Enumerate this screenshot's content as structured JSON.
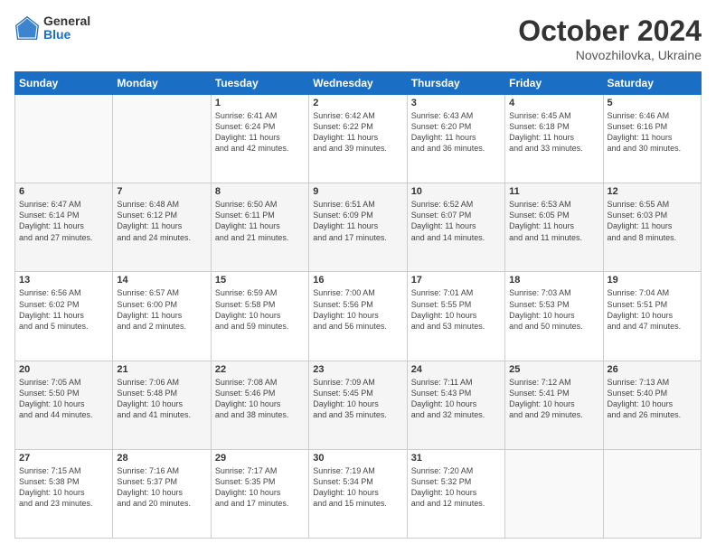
{
  "header": {
    "logo": {
      "general": "General",
      "blue": "Blue"
    },
    "title": "October 2024",
    "location": "Novozhilovka, Ukraine"
  },
  "days_of_week": [
    "Sunday",
    "Monday",
    "Tuesday",
    "Wednesday",
    "Thursday",
    "Friday",
    "Saturday"
  ],
  "weeks": [
    [
      {
        "day": "",
        "sunrise": "",
        "sunset": "",
        "daylight": ""
      },
      {
        "day": "",
        "sunrise": "",
        "sunset": "",
        "daylight": ""
      },
      {
        "day": "1",
        "sunrise": "Sunrise: 6:41 AM",
        "sunset": "Sunset: 6:24 PM",
        "daylight": "Daylight: 11 hours and 42 minutes."
      },
      {
        "day": "2",
        "sunrise": "Sunrise: 6:42 AM",
        "sunset": "Sunset: 6:22 PM",
        "daylight": "Daylight: 11 hours and 39 minutes."
      },
      {
        "day": "3",
        "sunrise": "Sunrise: 6:43 AM",
        "sunset": "Sunset: 6:20 PM",
        "daylight": "Daylight: 11 hours and 36 minutes."
      },
      {
        "day": "4",
        "sunrise": "Sunrise: 6:45 AM",
        "sunset": "Sunset: 6:18 PM",
        "daylight": "Daylight: 11 hours and 33 minutes."
      },
      {
        "day": "5",
        "sunrise": "Sunrise: 6:46 AM",
        "sunset": "Sunset: 6:16 PM",
        "daylight": "Daylight: 11 hours and 30 minutes."
      }
    ],
    [
      {
        "day": "6",
        "sunrise": "Sunrise: 6:47 AM",
        "sunset": "Sunset: 6:14 PM",
        "daylight": "Daylight: 11 hours and 27 minutes."
      },
      {
        "day": "7",
        "sunrise": "Sunrise: 6:48 AM",
        "sunset": "Sunset: 6:12 PM",
        "daylight": "Daylight: 11 hours and 24 minutes."
      },
      {
        "day": "8",
        "sunrise": "Sunrise: 6:50 AM",
        "sunset": "Sunset: 6:11 PM",
        "daylight": "Daylight: 11 hours and 21 minutes."
      },
      {
        "day": "9",
        "sunrise": "Sunrise: 6:51 AM",
        "sunset": "Sunset: 6:09 PM",
        "daylight": "Daylight: 11 hours and 17 minutes."
      },
      {
        "day": "10",
        "sunrise": "Sunrise: 6:52 AM",
        "sunset": "Sunset: 6:07 PM",
        "daylight": "Daylight: 11 hours and 14 minutes."
      },
      {
        "day": "11",
        "sunrise": "Sunrise: 6:53 AM",
        "sunset": "Sunset: 6:05 PM",
        "daylight": "Daylight: 11 hours and 11 minutes."
      },
      {
        "day": "12",
        "sunrise": "Sunrise: 6:55 AM",
        "sunset": "Sunset: 6:03 PM",
        "daylight": "Daylight: 11 hours and 8 minutes."
      }
    ],
    [
      {
        "day": "13",
        "sunrise": "Sunrise: 6:56 AM",
        "sunset": "Sunset: 6:02 PM",
        "daylight": "Daylight: 11 hours and 5 minutes."
      },
      {
        "day": "14",
        "sunrise": "Sunrise: 6:57 AM",
        "sunset": "Sunset: 6:00 PM",
        "daylight": "Daylight: 11 hours and 2 minutes."
      },
      {
        "day": "15",
        "sunrise": "Sunrise: 6:59 AM",
        "sunset": "Sunset: 5:58 PM",
        "daylight": "Daylight: 10 hours and 59 minutes."
      },
      {
        "day": "16",
        "sunrise": "Sunrise: 7:00 AM",
        "sunset": "Sunset: 5:56 PM",
        "daylight": "Daylight: 10 hours and 56 minutes."
      },
      {
        "day": "17",
        "sunrise": "Sunrise: 7:01 AM",
        "sunset": "Sunset: 5:55 PM",
        "daylight": "Daylight: 10 hours and 53 minutes."
      },
      {
        "day": "18",
        "sunrise": "Sunrise: 7:03 AM",
        "sunset": "Sunset: 5:53 PM",
        "daylight": "Daylight: 10 hours and 50 minutes."
      },
      {
        "day": "19",
        "sunrise": "Sunrise: 7:04 AM",
        "sunset": "Sunset: 5:51 PM",
        "daylight": "Daylight: 10 hours and 47 minutes."
      }
    ],
    [
      {
        "day": "20",
        "sunrise": "Sunrise: 7:05 AM",
        "sunset": "Sunset: 5:50 PM",
        "daylight": "Daylight: 10 hours and 44 minutes."
      },
      {
        "day": "21",
        "sunrise": "Sunrise: 7:06 AM",
        "sunset": "Sunset: 5:48 PM",
        "daylight": "Daylight: 10 hours and 41 minutes."
      },
      {
        "day": "22",
        "sunrise": "Sunrise: 7:08 AM",
        "sunset": "Sunset: 5:46 PM",
        "daylight": "Daylight: 10 hours and 38 minutes."
      },
      {
        "day": "23",
        "sunrise": "Sunrise: 7:09 AM",
        "sunset": "Sunset: 5:45 PM",
        "daylight": "Daylight: 10 hours and 35 minutes."
      },
      {
        "day": "24",
        "sunrise": "Sunrise: 7:11 AM",
        "sunset": "Sunset: 5:43 PM",
        "daylight": "Daylight: 10 hours and 32 minutes."
      },
      {
        "day": "25",
        "sunrise": "Sunrise: 7:12 AM",
        "sunset": "Sunset: 5:41 PM",
        "daylight": "Daylight: 10 hours and 29 minutes."
      },
      {
        "day": "26",
        "sunrise": "Sunrise: 7:13 AM",
        "sunset": "Sunset: 5:40 PM",
        "daylight": "Daylight: 10 hours and 26 minutes."
      }
    ],
    [
      {
        "day": "27",
        "sunrise": "Sunrise: 7:15 AM",
        "sunset": "Sunset: 5:38 PM",
        "daylight": "Daylight: 10 hours and 23 minutes."
      },
      {
        "day": "28",
        "sunrise": "Sunrise: 7:16 AM",
        "sunset": "Sunset: 5:37 PM",
        "daylight": "Daylight: 10 hours and 20 minutes."
      },
      {
        "day": "29",
        "sunrise": "Sunrise: 7:17 AM",
        "sunset": "Sunset: 5:35 PM",
        "daylight": "Daylight: 10 hours and 17 minutes."
      },
      {
        "day": "30",
        "sunrise": "Sunrise: 7:19 AM",
        "sunset": "Sunset: 5:34 PM",
        "daylight": "Daylight: 10 hours and 15 minutes."
      },
      {
        "day": "31",
        "sunrise": "Sunrise: 7:20 AM",
        "sunset": "Sunset: 5:32 PM",
        "daylight": "Daylight: 10 hours and 12 minutes."
      },
      {
        "day": "",
        "sunrise": "",
        "sunset": "",
        "daylight": ""
      },
      {
        "day": "",
        "sunrise": "",
        "sunset": "",
        "daylight": ""
      }
    ]
  ]
}
